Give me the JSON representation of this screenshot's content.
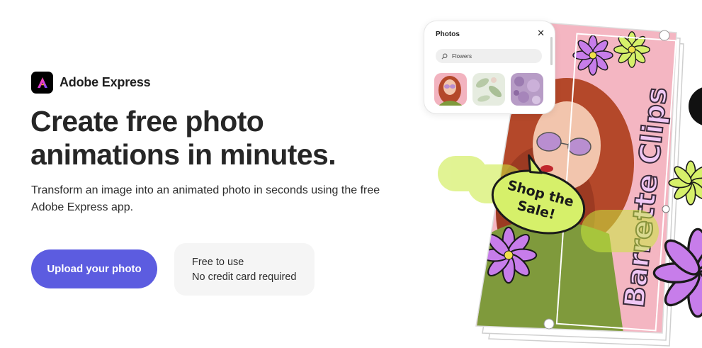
{
  "brand": {
    "name": "Adobe Express",
    "logo_icon": "adobe-express-logo"
  },
  "hero": {
    "headline_line1": "Create free photo",
    "headline_line2": "animations in minutes.",
    "subtext": "Transform an image into an animated photo in seconds using the free Adobe Express app."
  },
  "cta": {
    "upload_label": "Upload your photo",
    "accent": "#5c5ce0"
  },
  "info": {
    "line1": "Free to use",
    "line2": "No credit card required"
  },
  "photos_panel": {
    "title": "Photos",
    "close_icon": "close-icon",
    "search_value": "Flowers",
    "search_icon": "search-icon"
  },
  "artwork": {
    "speech_bubble": "Shop the Sale!",
    "vertical_text": "Barrette Clips",
    "colors": {
      "pink": "#f4b6c2",
      "lime": "#d6f06a",
      "purple": "#c77dea"
    }
  }
}
